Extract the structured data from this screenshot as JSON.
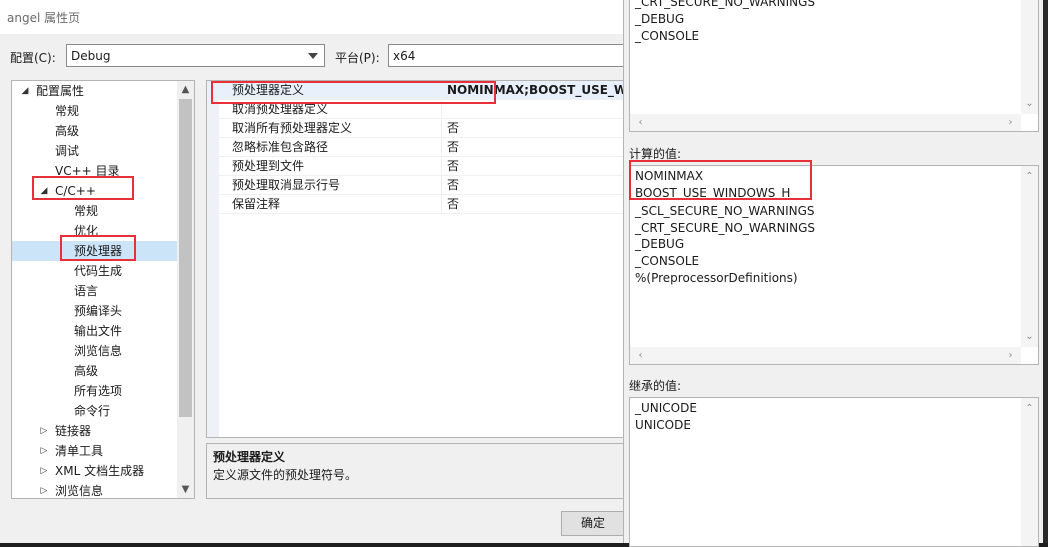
{
  "window": {
    "title": "angel 属性页"
  },
  "config": {
    "label": "配置(C):",
    "value": "Debug"
  },
  "platform": {
    "label": "平台(P):",
    "value": "x64"
  },
  "tree": {
    "items": [
      {
        "label": "配置属性",
        "expander": "◢"
      },
      {
        "label": "常规"
      },
      {
        "label": "高级"
      },
      {
        "label": "调试"
      },
      {
        "label": "VC++ 目录"
      },
      {
        "label": "C/C++",
        "expander": "◢"
      },
      {
        "label": "常规"
      },
      {
        "label": "优化"
      },
      {
        "label": "预处理器"
      },
      {
        "label": "代码生成"
      },
      {
        "label": "语言"
      },
      {
        "label": "预编译头"
      },
      {
        "label": "输出文件"
      },
      {
        "label": "浏览信息"
      },
      {
        "label": "高级"
      },
      {
        "label": "所有选项"
      },
      {
        "label": "命令行"
      },
      {
        "label": "链接器",
        "expander": "▷"
      },
      {
        "label": "清单工具",
        "expander": "▷"
      },
      {
        "label": "XML 文档生成器",
        "expander": "▷"
      },
      {
        "label": "浏览信息",
        "expander": "▷"
      }
    ]
  },
  "grid": {
    "rows": [
      {
        "name": "预处理器定义",
        "value": "NOMINMAX;BOOST_USE_WIN"
      },
      {
        "name": "取消预处理器定义",
        "value": ""
      },
      {
        "name": "取消所有预处理器定义",
        "value": "否"
      },
      {
        "name": "忽略标准包含路径",
        "value": "否"
      },
      {
        "name": "预处理到文件",
        "value": "否"
      },
      {
        "name": "预处理取消显示行号",
        "value": "否"
      },
      {
        "name": "保留注释",
        "value": "否"
      }
    ]
  },
  "description": {
    "title": "预处理器定义",
    "text": "定义源文件的预处理符号。"
  },
  "buttons": {
    "ok": "确定"
  },
  "right": {
    "top_lines": [
      "_CRT_SECURE_NO_WARNINGS",
      "_DEBUG",
      "_CONSOLE"
    ],
    "computed_label": "计算的值:",
    "computed_lines": [
      "NOMINMAX",
      "BOOST_USE_WINDOWS_H",
      "_SCL_SECURE_NO_WARNINGS",
      "_CRT_SECURE_NO_WARNINGS",
      "_DEBUG",
      "_CONSOLE",
      "%(PreprocessorDefinitions)"
    ],
    "inherited_label": "继承的值:",
    "inherited_lines": [
      "_UNICODE",
      "UNICODE"
    ]
  },
  "colors": {
    "highlight": "#e8303a",
    "selection": "#cce4f7"
  },
  "icons": {
    "tree_scroll_up": "chevron-up-icon",
    "tree_scroll_down": "chevron-down-icon",
    "combo_arrow": "chevron-down-icon"
  }
}
